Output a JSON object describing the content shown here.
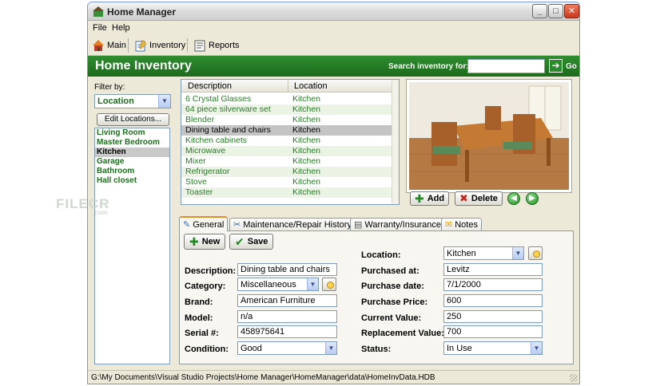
{
  "window": {
    "title": "Home Manager"
  },
  "menu": {
    "items": [
      "File",
      "Help"
    ]
  },
  "toolbar": {
    "main": "Main",
    "inventory": "Inventory",
    "reports": "Reports"
  },
  "header": {
    "title": "Home Inventory",
    "search_label": "Search inventory for:",
    "search_value": "",
    "go_label": "Go"
  },
  "filter": {
    "label": "Filter by:",
    "selected": "Location",
    "edit_button": "Edit Locations...",
    "locations": [
      "Living Room",
      "Master Bedroom",
      "Kitchen",
      "Garage",
      "Bathroom",
      "Hall closet"
    ],
    "selected_location": "Kitchen"
  },
  "grid": {
    "columns": [
      "Description",
      "Location"
    ],
    "rows": [
      [
        "6 Crystal Glasses",
        "Kitchen"
      ],
      [
        "64 piece silverware set",
        "Kitchen"
      ],
      [
        "Blender",
        "Kitchen"
      ],
      [
        "Dining table and chairs",
        "Kitchen"
      ],
      [
        "Kitchen cabinets",
        "Kitchen"
      ],
      [
        "Microwave",
        "Kitchen"
      ],
      [
        "Mixer",
        "Kitchen"
      ],
      [
        "Refrigerator",
        "Kitchen"
      ],
      [
        "Stove",
        "Kitchen"
      ],
      [
        "Toaster",
        "Kitchen"
      ]
    ],
    "selected_row": 3
  },
  "photo": {
    "add": "Add",
    "delete": "Delete"
  },
  "watermark": {
    "text": "FILECR",
    "sub": ".com"
  },
  "tabs": [
    "General",
    "Maintenance/Repair History",
    "Warranty/Insurance",
    "Notes"
  ],
  "actions": {
    "new": "New",
    "save": "Save"
  },
  "form": {
    "description_label": "Description:",
    "description": "Dining table and chairs",
    "category_label": "Category:",
    "category": "Miscellaneous",
    "brand_label": "Brand:",
    "brand": "American Furniture",
    "model_label": "Model:",
    "model": "n/a",
    "serial_label": "Serial #:",
    "serial": "458975641",
    "condition_label": "Condition:",
    "condition": "Good",
    "location_label": "Location:",
    "location": "Kitchen",
    "purchased_at_label": "Purchased at:",
    "purchased_at": "Levitz",
    "purchase_date_label": "Purchase date:",
    "purchase_date": "7/1/2000",
    "purchase_price_label": "Purchase Price:",
    "purchase_price": "600",
    "current_value_label": "Current Value:",
    "current_value": "250",
    "replacement_value_label": "Replacement Value:",
    "replacement_value": "700",
    "status_label": "Status:",
    "status": "In Use"
  },
  "statusbar": {
    "path": "G:\\My Documents\\Visual Studio Projects\\Home Manager\\HomeManager\\data\\HomeInvData.HDB"
  },
  "colors": {
    "header_green": "#1f7a1f",
    "item_green": "#2a7a2a",
    "selection": "#c4c4c4"
  }
}
